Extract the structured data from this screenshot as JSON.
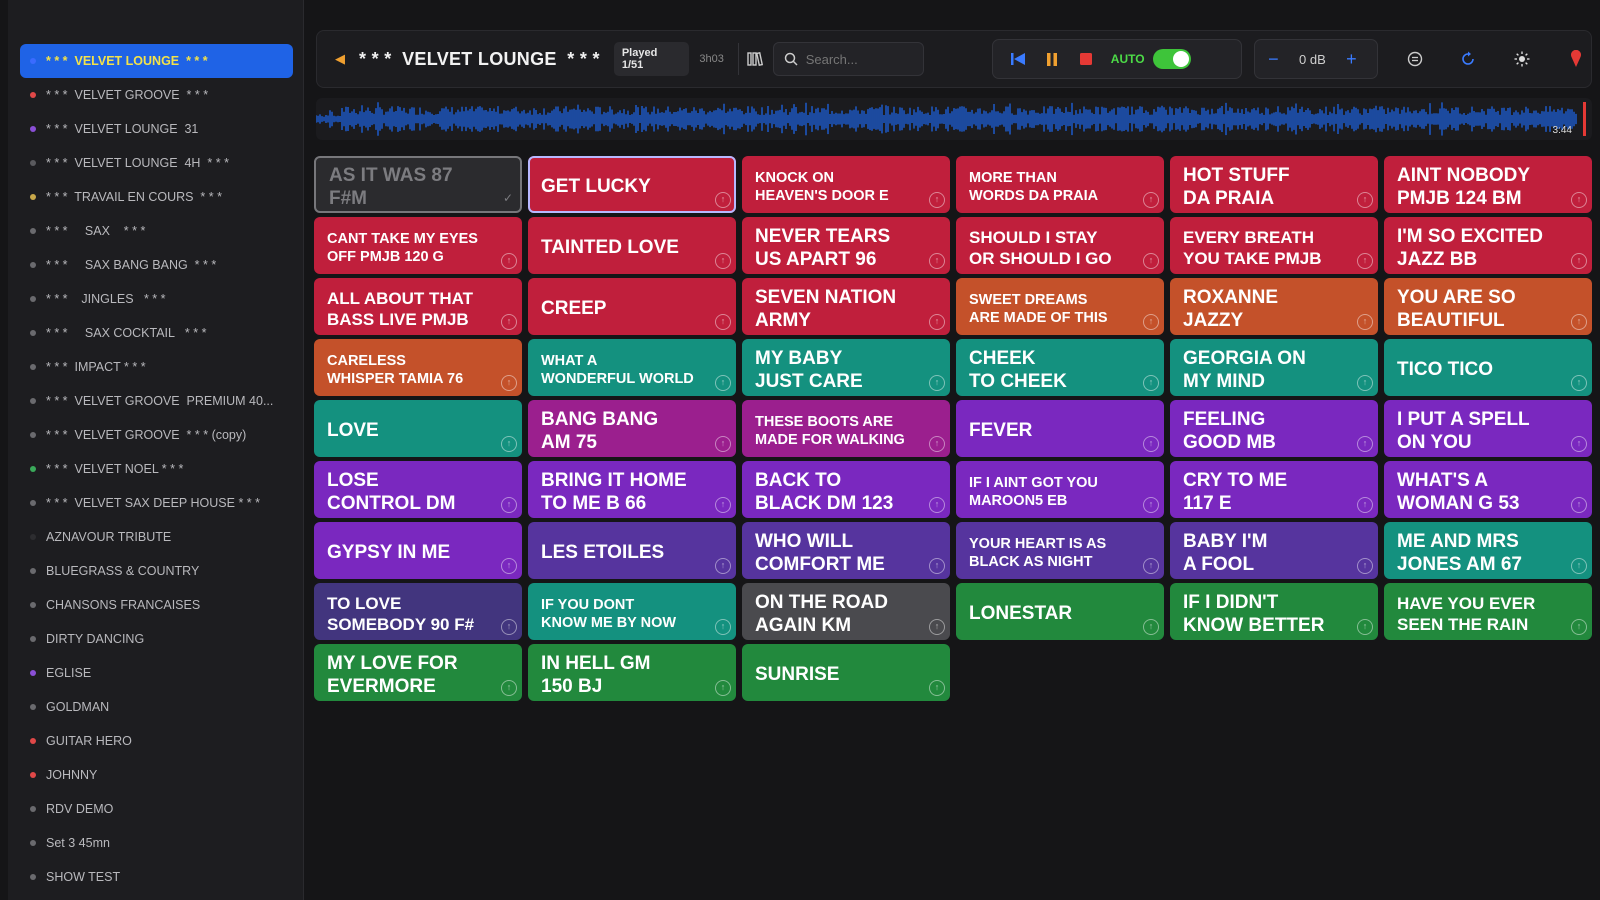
{
  "sidebar": {
    "items": [
      {
        "label": "* * *  VELVET LOUNGE  * * *",
        "dot": "#3a6bff",
        "active": true
      },
      {
        "label": "* * *  VELVET GROOVE  * * *",
        "dot": "#e04848"
      },
      {
        "label": "* * *  VELVET LOUNGE  31",
        "dot": "#8a4fd6"
      },
      {
        "label": "* * *  VELVET LOUNGE  4H  * * *",
        "dot": "#5a5a5e"
      },
      {
        "label": "* * *  TRAVAIL EN COURS  * * *",
        "dot": "#c8a84a"
      },
      {
        "label": "* * *     SAX    * * *",
        "dot": "#6a6a6e"
      },
      {
        "label": "* * *     SAX BANG BANG  * * *",
        "dot": "#6a6a6e"
      },
      {
        "label": "* * *    JINGLES   * * *",
        "dot": "#6a6a6e"
      },
      {
        "label": "* * *     SAX COCKTAIL   * * *",
        "dot": "#6a6a6e"
      },
      {
        "label": "* * *  IMPACT * * *",
        "dot": "#6a6a6e"
      },
      {
        "label": "* * *  VELVET GROOVE  PREMIUM 40...",
        "dot": "#6a6a6e"
      },
      {
        "label": "* * *  VELVET GROOVE  * * * (copy)",
        "dot": "#6a6a6e"
      },
      {
        "label": "* * *  VELVET NOEL * * *",
        "dot": "#3aa95a"
      },
      {
        "label": "* * *  VELVET SAX DEEP HOUSE * * *",
        "dot": "#6a6a6e"
      },
      {
        "label": "AZNAVOUR TRIBUTE",
        "dot": "#2d2d30"
      },
      {
        "label": "BLUEGRASS & COUNTRY",
        "dot": "#6a6a6e"
      },
      {
        "label": "CHANSONS FRANCAISES",
        "dot": "#6a6a6e"
      },
      {
        "label": "DIRTY DANCING",
        "dot": "#6a6a6e"
      },
      {
        "label": "EGLISE",
        "dot": "#8a4fd6"
      },
      {
        "label": "GOLDMAN",
        "dot": "#6a6a6e"
      },
      {
        "label": "GUITAR HERO",
        "dot": "#e04848"
      },
      {
        "label": "JOHNNY",
        "dot": "#e04848"
      },
      {
        "label": "RDV DEMO",
        "dot": "#6a6a6e"
      },
      {
        "label": "Set 3 45mn",
        "dot": "#6a6a6e"
      },
      {
        "label": "SHOW TEST",
        "dot": "#6a6a6e"
      }
    ]
  },
  "header": {
    "back_icon": "back-arrow-icon",
    "title": "* * *  VELVET LOUNGE  * * *",
    "played": "Played 1/51",
    "duration": "3h03",
    "search_placeholder": "Search...",
    "auto_label": "AUTO",
    "auto_on": true,
    "volume": "0 dB",
    "colors": {
      "accent_blue": "#3a6bff",
      "accent_orange": "#f0a030",
      "auto_green": "#3ec43a",
      "stop_red": "#e53935"
    }
  },
  "waveform": {
    "time": "3:44",
    "color": "#1d5fd6"
  },
  "tiles": [
    {
      "title": "AS IT WAS 87\nF#M",
      "color": "#2b2b2e",
      "size": "lg",
      "state": "played"
    },
    {
      "title": "GET LUCKY",
      "color": "#c01f3c",
      "size": "lg",
      "state": "selected"
    },
    {
      "title": "KNOCK ON\nHEAVEN'S DOOR E",
      "color": "#c01f3c",
      "size": "sm"
    },
    {
      "title": "MORE THAN\nWORDS DA PRAIA",
      "color": "#c01f3c",
      "size": "sm"
    },
    {
      "title": "HOT STUFF\nDA PRAIA",
      "color": "#c01f3c",
      "size": "lg"
    },
    {
      "title": "AINT NOBODY\nPMJB 124 BM",
      "color": "#c01f3c",
      "size": "lg"
    },
    {
      "title": "CANT TAKE MY EYES\nOFF PMJB 120 G",
      "color": "#c01f3c",
      "size": "sm"
    },
    {
      "title": "TAINTED LOVE",
      "color": "#c01f3c",
      "size": "lg"
    },
    {
      "title": "NEVER TEARS\nUS APART 96",
      "color": "#c01f3c",
      "size": "lg"
    },
    {
      "title": "SHOULD I STAY\nOR SHOULD I GO",
      "color": "#c01f3c",
      "size": "md"
    },
    {
      "title": "EVERY BREATH\nYOU TAKE PMJB",
      "color": "#c01f3c",
      "size": "md"
    },
    {
      "title": "I'M SO EXCITED\nJAZZ BB",
      "color": "#c01f3c",
      "size": "lg"
    },
    {
      "title": "ALL ABOUT THAT\nBASS LIVE PMJB",
      "color": "#c01f3c",
      "size": "md"
    },
    {
      "title": "CREEP",
      "color": "#c01f3c",
      "size": "lg"
    },
    {
      "title": "SEVEN NATION\nARMY",
      "color": "#c01f3c",
      "size": "lg"
    },
    {
      "title": "SWEET DREAMS\nARE MADE OF THIS",
      "color": "#c4512a",
      "size": "sm"
    },
    {
      "title": "ROXANNE\nJAZZY",
      "color": "#c4512a",
      "size": "lg"
    },
    {
      "title": "YOU ARE SO\nBEAUTIFUL",
      "color": "#c4512a",
      "size": "lg"
    },
    {
      "title": "CARELESS\nWHISPER TAMIA 76",
      "color": "#c4512a",
      "size": "sm"
    },
    {
      "title": "WHAT A\nWONDERFUL WORLD",
      "color": "#14917f",
      "size": "sm"
    },
    {
      "title": "MY BABY\nJUST CARE",
      "color": "#14917f",
      "size": "lg"
    },
    {
      "title": "CHEEK\nTO CHEEK",
      "color": "#14917f",
      "size": "lg"
    },
    {
      "title": "GEORGIA ON\nMY MIND",
      "color": "#14917f",
      "size": "lg"
    },
    {
      "title": "TICO TICO",
      "color": "#14917f",
      "size": "lg"
    },
    {
      "title": "LOVE",
      "color": "#14917f",
      "size": "lg"
    },
    {
      "title": "BANG BANG\nAM 75",
      "color": "#9b1f8e",
      "size": "lg"
    },
    {
      "title": "THESE BOOTS ARE\nMADE FOR WALKING",
      "color": "#9b1f8e",
      "size": "sm"
    },
    {
      "title": "FEVER",
      "color": "#7a28bf",
      "size": "lg"
    },
    {
      "title": "FEELING\nGOOD MB",
      "color": "#7a28bf",
      "size": "lg"
    },
    {
      "title": "I PUT A SPELL\nON YOU",
      "color": "#7a28bf",
      "size": "lg"
    },
    {
      "title": "LOSE\nCONTROL DM",
      "color": "#7a28bf",
      "size": "lg"
    },
    {
      "title": "BRING IT HOME\nTO ME B 66",
      "color": "#7a28bf",
      "size": "lg"
    },
    {
      "title": "BACK TO\nBLACK DM 123",
      "color": "#7a28bf",
      "size": "lg"
    },
    {
      "title": "IF I AINT GOT YOU\nMAROON5 EB",
      "color": "#7a28bf",
      "size": "sm"
    },
    {
      "title": "CRY TO ME\n117 E",
      "color": "#7a28bf",
      "size": "lg"
    },
    {
      "title": "WHAT'S A\nWOMAN G 53",
      "color": "#7a28bf",
      "size": "lg"
    },
    {
      "title": "GYPSY IN ME",
      "color": "#7a28bf",
      "size": "lg"
    },
    {
      "title": "LES ETOILES",
      "color": "#56349e",
      "size": "lg"
    },
    {
      "title": "WHO WILL\nCOMFORT ME",
      "color": "#56349e",
      "size": "lg"
    },
    {
      "title": "YOUR HEART IS AS\nBLACK AS NIGHT",
      "color": "#56349e",
      "size": "sm"
    },
    {
      "title": "BABY I'M\nA FOOL",
      "color": "#56349e",
      "size": "lg"
    },
    {
      "title": "ME AND MRS\nJONES AM 67",
      "color": "#14917f",
      "size": "lg"
    },
    {
      "title": "TO LOVE\nSOMEBODY 90 F#",
      "color": "#42357e",
      "size": "md"
    },
    {
      "title": "IF YOU DONT\nKNOW ME BY NOW",
      "color": "#14917f",
      "size": "sm"
    },
    {
      "title": "ON THE ROAD\nAGAIN KM",
      "color": "#4a4a4e",
      "size": "lg"
    },
    {
      "title": "LONESTAR",
      "color": "#22893d",
      "size": "lg"
    },
    {
      "title": "IF I DIDN'T\nKNOW BETTER",
      "color": "#22893d",
      "size": "lg"
    },
    {
      "title": "HAVE YOU EVER\nSEEN THE RAIN",
      "color": "#22893d",
      "size": "md"
    },
    {
      "title": "MY LOVE FOR\nEVERMORE",
      "color": "#22893d",
      "size": "lg"
    },
    {
      "title": "IN HELL GM\n150 BJ",
      "color": "#22893d",
      "size": "lg"
    },
    {
      "title": "SUNRISE",
      "color": "#22893d",
      "size": "lg"
    }
  ]
}
